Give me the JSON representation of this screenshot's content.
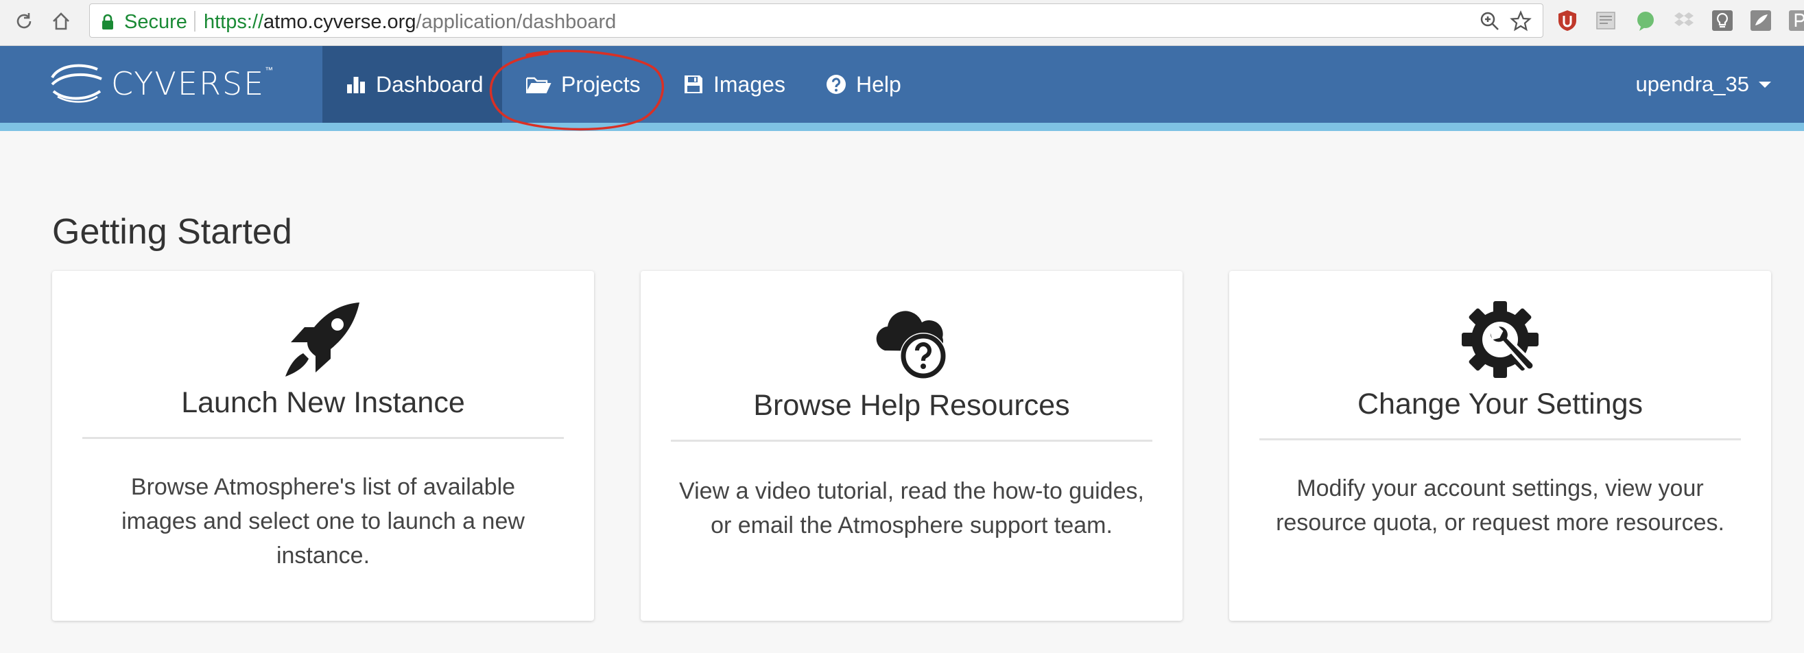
{
  "browser": {
    "secure_label": "Secure",
    "url_scheme": "https://",
    "url_host": "atmo.cyverse.org",
    "url_path": "/application/dashboard"
  },
  "brand": {
    "name": "CYVERSE",
    "tm": "™"
  },
  "nav": {
    "items": [
      {
        "label": "Dashboard",
        "icon": "bar-chart-icon"
      },
      {
        "label": "Projects",
        "icon": "folder-open-icon"
      },
      {
        "label": "Images",
        "icon": "floppy-disk-icon"
      },
      {
        "label": "Help",
        "icon": "question-circle-icon"
      }
    ],
    "active": "Dashboard",
    "user": "upendra_35"
  },
  "annotation": {
    "color": "#d93025",
    "target": "Projects"
  },
  "main": {
    "title": "Getting Started",
    "cards": [
      {
        "icon": "rocket-icon",
        "title": "Launch New Instance",
        "desc_lines": [
          "Browse Atmosphere's list of available",
          "images and select one to launch a new",
          "instance."
        ]
      },
      {
        "icon": "cloud-question-icon",
        "title": "Browse Help Resources",
        "desc_lines": [
          "View a video tutorial, read the how-to guides,",
          "or email the Atmosphere support team."
        ]
      },
      {
        "icon": "gear-wrench-icon",
        "title": "Change Your Settings",
        "desc_lines": [
          "Modify your account settings, view your",
          "resource quota, or request more resources."
        ]
      }
    ]
  },
  "colors": {
    "nav_bg": "#3e6ea7",
    "nav_active": "#2d5586",
    "stripe": "#7ec2e4",
    "page_bg": "#f7f7f7",
    "secure_green": "#1a8a35"
  }
}
